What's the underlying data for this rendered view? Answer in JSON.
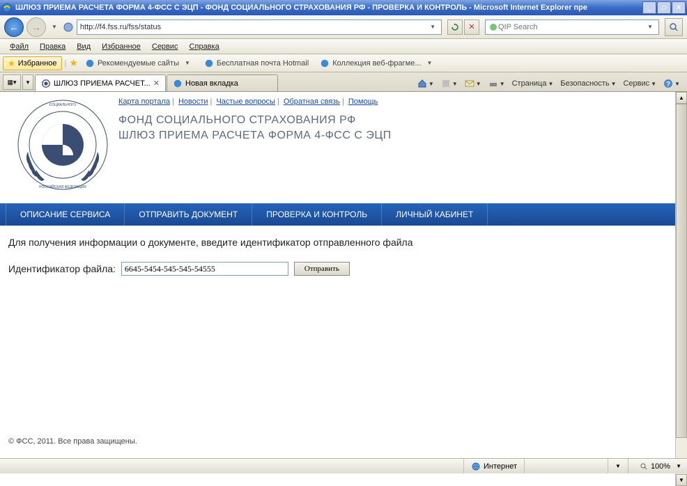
{
  "window": {
    "title": "ШЛЮЗ ПРИЕМА РАСЧЕТА ФОРМА 4-ФСС С ЭЦП - ФОНД СОЦИАЛЬНОГО СТРАХОВАНИЯ РФ - ПРОВЕРКА И КОНТРОЛЬ - Microsoft Internet Explorer пре"
  },
  "address": {
    "url": "http://f4.fss.ru/fss/status"
  },
  "search": {
    "placeholder": "QIP Search"
  },
  "menubar": {
    "items": [
      "Файл",
      "Правка",
      "Вид",
      "Избранное",
      "Сервис",
      "Справка"
    ]
  },
  "favbar": {
    "button": "Избранное",
    "items": [
      {
        "label": "Рекомендуемые сайты",
        "has_dropdown": true
      },
      {
        "label": "Бесплатная почта Hotmail",
        "has_dropdown": false
      },
      {
        "label": "Коллекция веб-фрагме...",
        "has_dropdown": true
      }
    ]
  },
  "tabs": [
    {
      "label": "ШЛЮЗ ПРИЕМА РАСЧЕТ...",
      "active": true
    },
    {
      "label": "Новая вкладка",
      "active": false
    }
  ],
  "tabtools": {
    "page": "Страница",
    "security": "Безопасность",
    "service": "Сервис"
  },
  "page": {
    "top_links": [
      "Карта портала",
      "Новости",
      "Частые вопросы",
      "Обратная связь",
      "Помощь"
    ],
    "org_title": "ФОНД СОЦИАЛЬНОГО СТРАХОВАНИЯ РФ",
    "org_subtitle": "ШЛЮЗ ПРИЕМА РАСЧЕТА ФОРМА 4-ФСС С ЭЦП",
    "nav": [
      "ОПИСАНИЕ СЕРВИСА",
      "ОТПРАВИТЬ ДОКУМЕНТ",
      "ПРОВЕРКА И КОНТРОЛЬ",
      "ЛИЧНЫЙ КАБИНЕТ"
    ],
    "form": {
      "prompt": "Для получения информации о документе, введите идентификатор отправленного файла",
      "label": "Идентификатор файла:",
      "value": "6645-5454-545-545-54555",
      "submit": "Отправить"
    },
    "footer": "© ФСС, 2011. Все права защищены."
  },
  "statusbar": {
    "zone": "Интернет",
    "zoom": "100%"
  }
}
